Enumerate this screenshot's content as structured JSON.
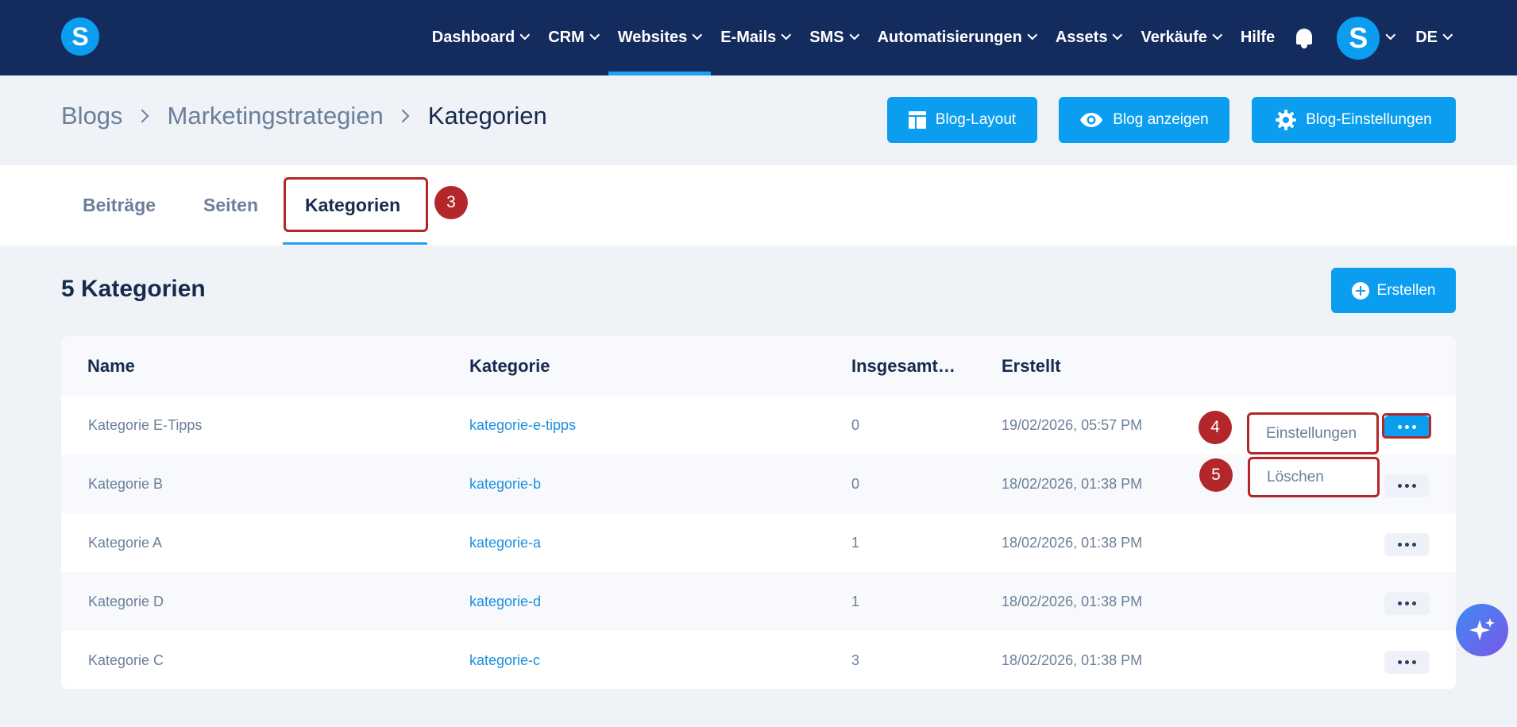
{
  "nav": {
    "logo_letter": "S",
    "items": [
      {
        "label": "Dashboard",
        "has_dropdown": true,
        "active": false
      },
      {
        "label": "CRM",
        "has_dropdown": true,
        "active": false
      },
      {
        "label": "Websites",
        "has_dropdown": true,
        "active": true
      },
      {
        "label": "E-Mails",
        "has_dropdown": true,
        "active": false
      },
      {
        "label": "SMS",
        "has_dropdown": true,
        "active": false
      },
      {
        "label": "Automatisierungen",
        "has_dropdown": true,
        "active": false
      },
      {
        "label": "Assets",
        "has_dropdown": true,
        "active": false
      },
      {
        "label": "Verkäufe",
        "has_dropdown": true,
        "active": false
      },
      {
        "label": "Hilfe",
        "has_dropdown": false,
        "active": false
      }
    ],
    "avatar_letter": "S",
    "language": "DE",
    "bell_icon": "bell-icon"
  },
  "breadcrumb": [
    "Blogs",
    "Marketingstrategien",
    "Kategorien"
  ],
  "header_buttons": {
    "layout": "Blog-Layout",
    "view": "Blog anzeigen",
    "settings": "Blog-Einstellungen"
  },
  "tabs": [
    {
      "label": "Beiträge",
      "active": false
    },
    {
      "label": "Seiten",
      "active": false
    },
    {
      "label": "Kategorien",
      "active": true
    }
  ],
  "annotations": {
    "tab_badge": "3",
    "settings_badge": "4",
    "delete_badge": "5"
  },
  "section": {
    "title": "5 Kategorien",
    "create_label": "Erstellen"
  },
  "table": {
    "columns": [
      "Name",
      "Kategorie",
      "Insgesamt…",
      "Erstellt"
    ],
    "rows": [
      {
        "name": "Kategorie E-Tipps",
        "slug": "kategorie-e-tipps",
        "total": "0",
        "created": "19/02/2026, 05:57 PM"
      },
      {
        "name": "Kategorie B",
        "slug": "kategorie-b",
        "total": "0",
        "created": "18/02/2026, 01:38 PM"
      },
      {
        "name": "Kategorie A",
        "slug": "kategorie-a",
        "total": "1",
        "created": "18/02/2026, 01:38 PM"
      },
      {
        "name": "Kategorie D",
        "slug": "kategorie-d",
        "total": "1",
        "created": "18/02/2026, 01:38 PM"
      },
      {
        "name": "Kategorie C",
        "slug": "kategorie-c",
        "total": "3",
        "created": "18/02/2026, 01:38 PM"
      }
    ]
  },
  "row_menu": {
    "settings": "Einstellungen",
    "delete": "Löschen"
  },
  "colors": {
    "nav_bg": "#142b5e",
    "accent": "#0b9ef0",
    "highlight": "#b3262a",
    "page_bg": "#eff3f8"
  }
}
